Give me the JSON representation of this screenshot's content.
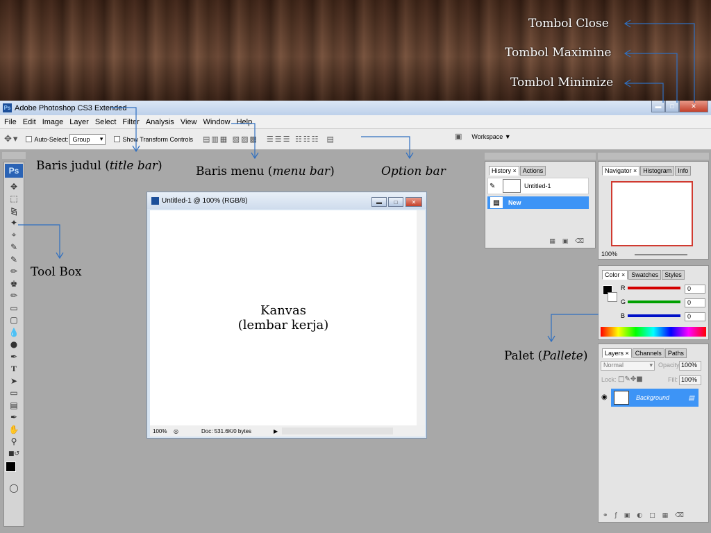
{
  "annotations": {
    "tombol_close": "Tombol Close",
    "tombol_maximine": "Tombol Maximine",
    "tombol_minimize": "Tombol Minimize",
    "baris_judul_prefix": "Baris judul (",
    "baris_judul_italic": "title bar",
    "baris_menu_prefix": "Baris menu (",
    "baris_menu_italic": "menu bar",
    "option_bar": "Option bar",
    "tool_box": "Tool Box",
    "kanvas_line1": "Kanvas",
    "kanvas_line2": "(lembar kerja)",
    "palet_prefix": "Palet (",
    "palet_italic": "Pallete",
    "close_paren": ")"
  },
  "app": {
    "title": "Adobe Photoshop CS3 Extended",
    "menu": [
      "File",
      "Edit",
      "Image",
      "Layer",
      "Select",
      "Filter",
      "Analysis",
      "View",
      "Window",
      "Help"
    ],
    "options": {
      "auto_select_label": "Auto-Select:",
      "auto_select_value": "Group",
      "show_transform_label": "Show Transform Controls",
      "workspace_label": "Workspace ▼"
    }
  },
  "document": {
    "title": "Untitled-1 @ 100% (RGB/8)",
    "zoom": "100%",
    "doc_size": "Doc: 531.6K/0 bytes"
  },
  "panels": {
    "history": {
      "tabs": [
        "History ×",
        "Actions"
      ],
      "snapshot": "Untitled-1",
      "state": "New"
    },
    "navigator": {
      "tabs": [
        "Navigator ×",
        "Histogram",
        "Info"
      ],
      "zoom": "100%"
    },
    "color": {
      "tabs": [
        "Color ×",
        "Swatches",
        "Styles"
      ],
      "channels": [
        {
          "label": "R",
          "value": "0",
          "color": "#d40000"
        },
        {
          "label": "G",
          "value": "0",
          "color": "#00a000"
        },
        {
          "label": "B",
          "value": "0",
          "color": "#0010c8"
        }
      ]
    },
    "layers": {
      "tabs": [
        "Layers ×",
        "Channels",
        "Paths"
      ],
      "blend_mode": "Normal",
      "opacity_label": "Opacity:",
      "opacity_value": "100%",
      "lock_label": "Lock:",
      "fill_label": "Fill:",
      "fill_value": "100%",
      "layer_name": "Background"
    }
  },
  "colors": {
    "annotation_arrow": "#2f6fc0",
    "selection": "#3d94f6",
    "workspace_gray": "#a8a8a8"
  }
}
